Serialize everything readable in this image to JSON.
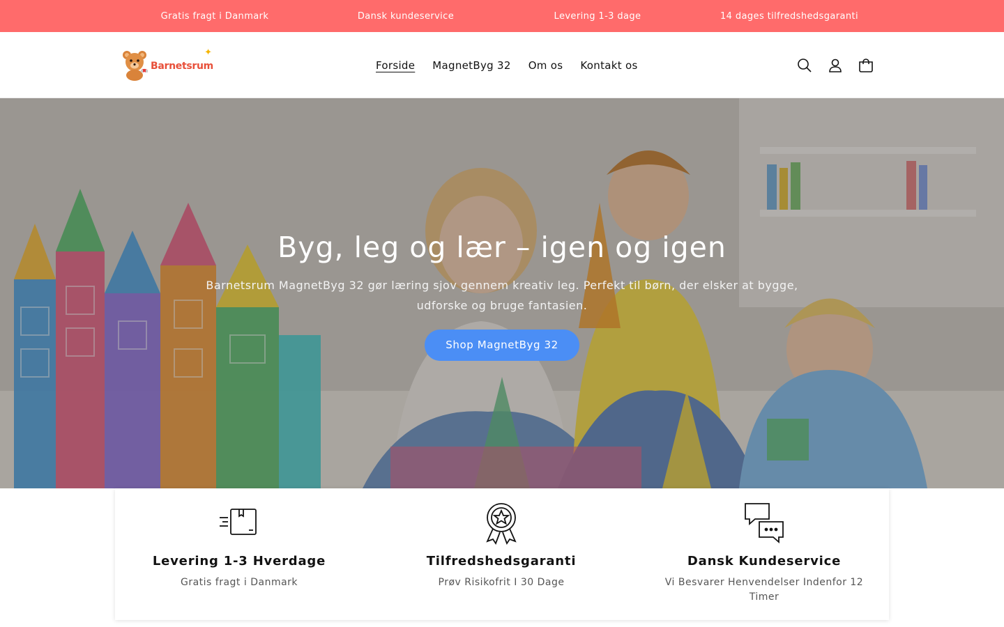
{
  "announcement": {
    "items": [
      "Gratis fragt i Danmark",
      "Dansk kundeservice",
      "Levering 1-3 dage",
      "14 dages tilfredshedsgaranti"
    ]
  },
  "header": {
    "logo_text": "Barnetsrum",
    "nav": [
      "Forside",
      "MagnetByg 32",
      "Om os",
      "Kontakt os"
    ],
    "active_nav": "Forside",
    "icons": [
      "search-icon",
      "account-icon",
      "cart-icon"
    ]
  },
  "hero": {
    "title": "Byg, leg og lær – igen og igen",
    "subtitle": "Barnetsrum MagnetByg 32 gør læring sjov gennem kreativ leg. Perfekt til børn, der elsker at bygge, udforske og bruge fantasien.",
    "button": "Shop MagnetByg 32"
  },
  "features": [
    {
      "icon": "delivery-box-icon",
      "title": "Levering 1-3 Hverdage",
      "text": "Gratis fragt i Danmark"
    },
    {
      "icon": "award-badge-icon",
      "title": "Tilfredshedsgaranti",
      "text": "Prøv Risikofrit I 30 Dage"
    },
    {
      "icon": "chat-bubbles-icon",
      "title": "Dansk Kundeservice",
      "text": "Vi Besvarer Henvendelser Indenfor 12 Timer"
    }
  ],
  "colors": {
    "announcement_bg": "#ff6b6b",
    "button_bg": "#4b8ef5",
    "logo_text": "#e8503a"
  }
}
